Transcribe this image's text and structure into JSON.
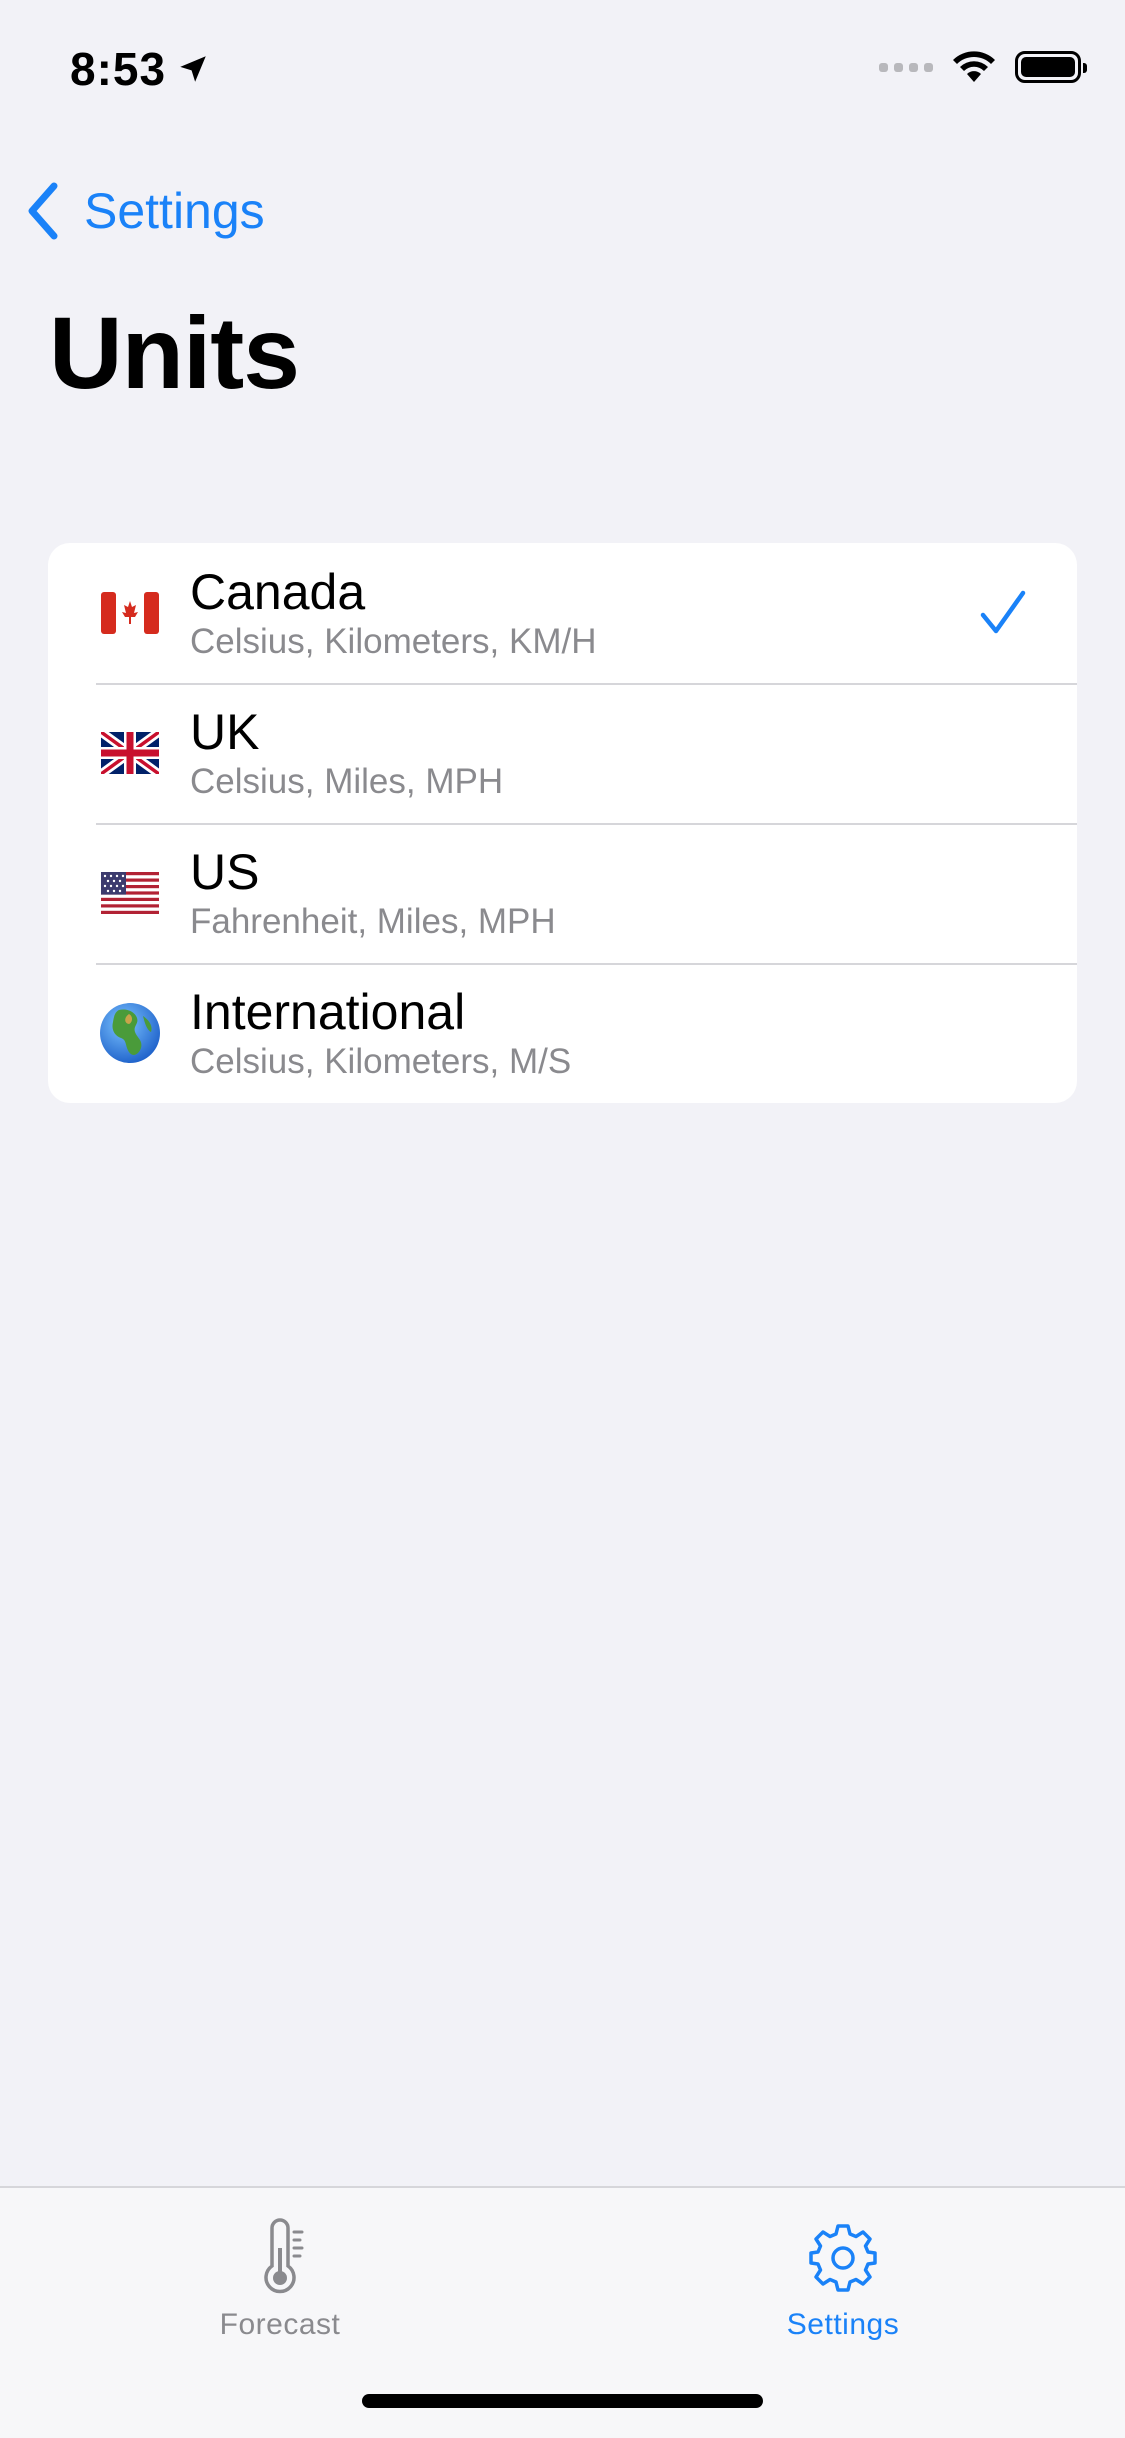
{
  "status_bar": {
    "time": "8:53",
    "location_icon": "location-arrow-icon",
    "wifi_icon": "wifi-icon",
    "battery_icon": "battery-icon",
    "battery_level": 1.0
  },
  "navigation": {
    "back_label": "Settings",
    "back_icon": "chevron-left-icon",
    "title": "Units"
  },
  "units_list": {
    "selected": "Canada",
    "items": [
      {
        "flag": "🇨🇦",
        "icon": "canada-flag-icon",
        "title": "Canada",
        "subtitle": "Celsius, Kilometers, KM/H",
        "selected": true
      },
      {
        "flag": "🇬🇧",
        "icon": "uk-flag-icon",
        "title": "UK",
        "subtitle": "Celsius, Miles, MPH",
        "selected": false
      },
      {
        "flag": "🇺🇸",
        "icon": "us-flag-icon",
        "title": "US",
        "subtitle": "Fahrenheit, Miles, MPH",
        "selected": false
      },
      {
        "flag": "🌍",
        "icon": "globe-icon",
        "title": "International",
        "subtitle": "Celsius, Kilometers, M/S",
        "selected": false
      }
    ]
  },
  "tab_bar": {
    "tabs": [
      {
        "label": "Forecast",
        "icon": "thermometer-icon",
        "active": false
      },
      {
        "label": "Settings",
        "icon": "gear-icon",
        "active": true
      }
    ]
  },
  "colors": {
    "accent": "#1a82f8",
    "background": "#f2f2f7",
    "secondary_text": "#8a8a8e"
  }
}
